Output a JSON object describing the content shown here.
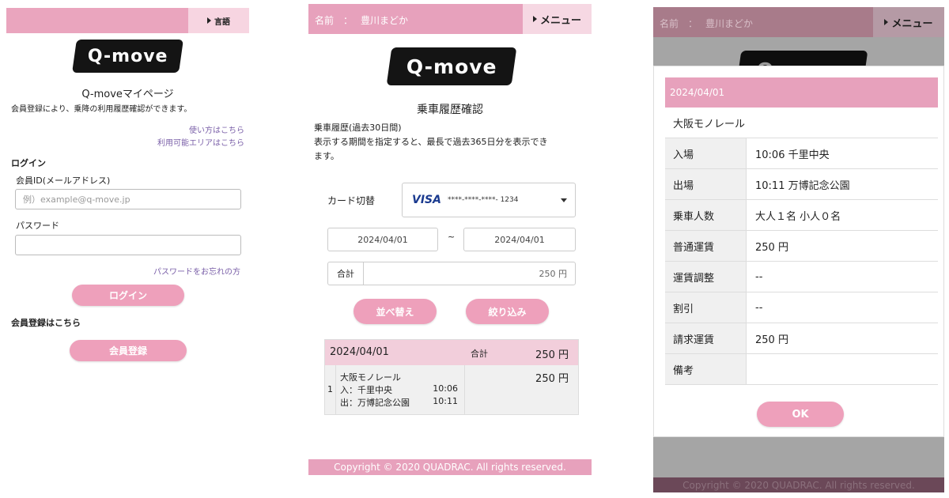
{
  "login_screen": {
    "language_label": "言語",
    "logo_text": "Q-move",
    "page_title": "Q-moveマイページ",
    "description": "会員登録により、乗降の利用履歴確認ができます。",
    "link_howto": "使い方はこちら",
    "link_area": "利用可能エリアはこちら",
    "login_heading": "ログイン",
    "member_id_label": "会員ID(メールアドレス)",
    "member_id_placeholder": "例）example@q-move.jp",
    "password_label": "パスワード",
    "forgot_password_link": "パスワードをお忘れの方",
    "login_button": "ログイン",
    "register_heading": "会員登録はこちら",
    "register_button": "会員登録"
  },
  "history_screen": {
    "name_label": "名前",
    "name_colon": "：",
    "user_name": "豊川まどか",
    "menu_label": "メニュー",
    "logo_text": "Q-move",
    "page_title": "乗車履歴確認",
    "desc_line1": "乗車履歴(過去30日間)",
    "desc_line2": "表示する期間を指定すると、最長で過去365日分を表示でき",
    "desc_line3": "ます。",
    "card_switch_label": "カード切替",
    "card_brand": "VISA",
    "card_number": "****-****-****- 1234",
    "date_from": "2024/04/01",
    "date_separator": "~",
    "date_to": "2024/04/01",
    "total_label": "合計",
    "total_value": "250 円",
    "sort_button": "並べ替え",
    "filter_button": "絞り込み",
    "result": {
      "date": "2024/04/01",
      "total_label": "合計",
      "total_value": "250 円",
      "index": "1",
      "operator": "大阪モノレール",
      "entry_line": "入：千里中央",
      "entry_time": "10:06",
      "exit_line": "出：万博記念公園",
      "exit_time": "10:11",
      "fare": "250 円"
    },
    "copyright": "Copyright © 2020 QUADRAC. All rights reserved."
  },
  "detail_screen": {
    "name_label": "名前",
    "name_colon": "：",
    "user_name": "豊川まどか",
    "menu_label": "メニュー",
    "logo_text": "Q-move",
    "modal_date": "2024/04/01",
    "operator": "大阪モノレール",
    "rows": [
      {
        "label": "入場",
        "value": "10:06 千里中央"
      },
      {
        "label": "出場",
        "value": "10:11 万博記念公園"
      },
      {
        "label": "乗車人数",
        "value": "大人１名  小人０名"
      },
      {
        "label": "普通運賃",
        "value": "250 円"
      },
      {
        "label": "運賃調整",
        "value": "--"
      },
      {
        "label": "割引",
        "value": "--"
      },
      {
        "label": "請求運賃",
        "value": "250 円"
      },
      {
        "label": "備考",
        "value": ""
      }
    ],
    "ok_button": "OK",
    "copyright": "Copyright © 2020 QUADRAC. All rights reserved."
  },
  "colors": {
    "brand_pink": "#e7a1bc",
    "light_pink": "#f6d6e2",
    "button_pink": "#eea0bb",
    "link_purple": "#7a5fa8",
    "logo_black": "#141414"
  }
}
